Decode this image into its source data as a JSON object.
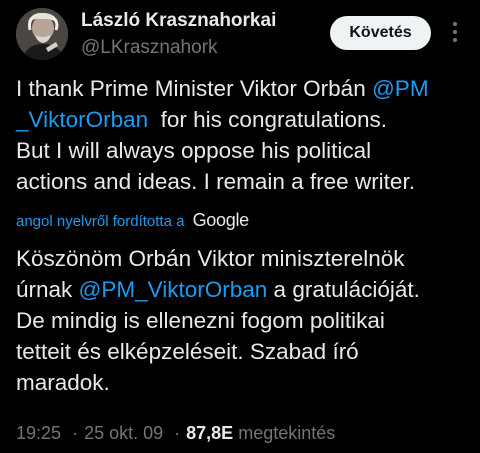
{
  "author": {
    "display_name": "László Krasznahorkai",
    "handle": "@LKrasznahork"
  },
  "follow_label": "Követés",
  "tweet": {
    "line1_text": "I thank Prime Minister Viktor Orbán ",
    "line1_mention": "@PM",
    "line2_mention": "_ViktorOrban",
    "line2_text": "  for his congratulations.",
    "line3": "But I will always oppose his political",
    "line4": "actions and ideas. I remain a free writer."
  },
  "translation_note": "angol nyelvről fordította a",
  "translation_provider": "Google",
  "translation": {
    "line1": "Köszönöm Orbán Viktor miniszterelnök",
    "line2_pre": "úrnak ",
    "line2_mention": "@PM_ViktorOrban",
    "line2_post": " a gratulációját.",
    "line3": "De mindig is ellenezni fogom politikai",
    "line4": "tetteit és elképzeléseit. Szabad író",
    "line5": "maradok."
  },
  "meta": {
    "time": "19:25",
    "dot": "·",
    "date": "25 okt. 09",
    "views_count": "87,8E",
    "views_label": "megtekintés"
  },
  "colors": {
    "background": "#000000",
    "text": "#e7e9ea",
    "secondary": "#71767b",
    "accent": "#1d9bf0",
    "button_bg": "#eff3f4"
  }
}
